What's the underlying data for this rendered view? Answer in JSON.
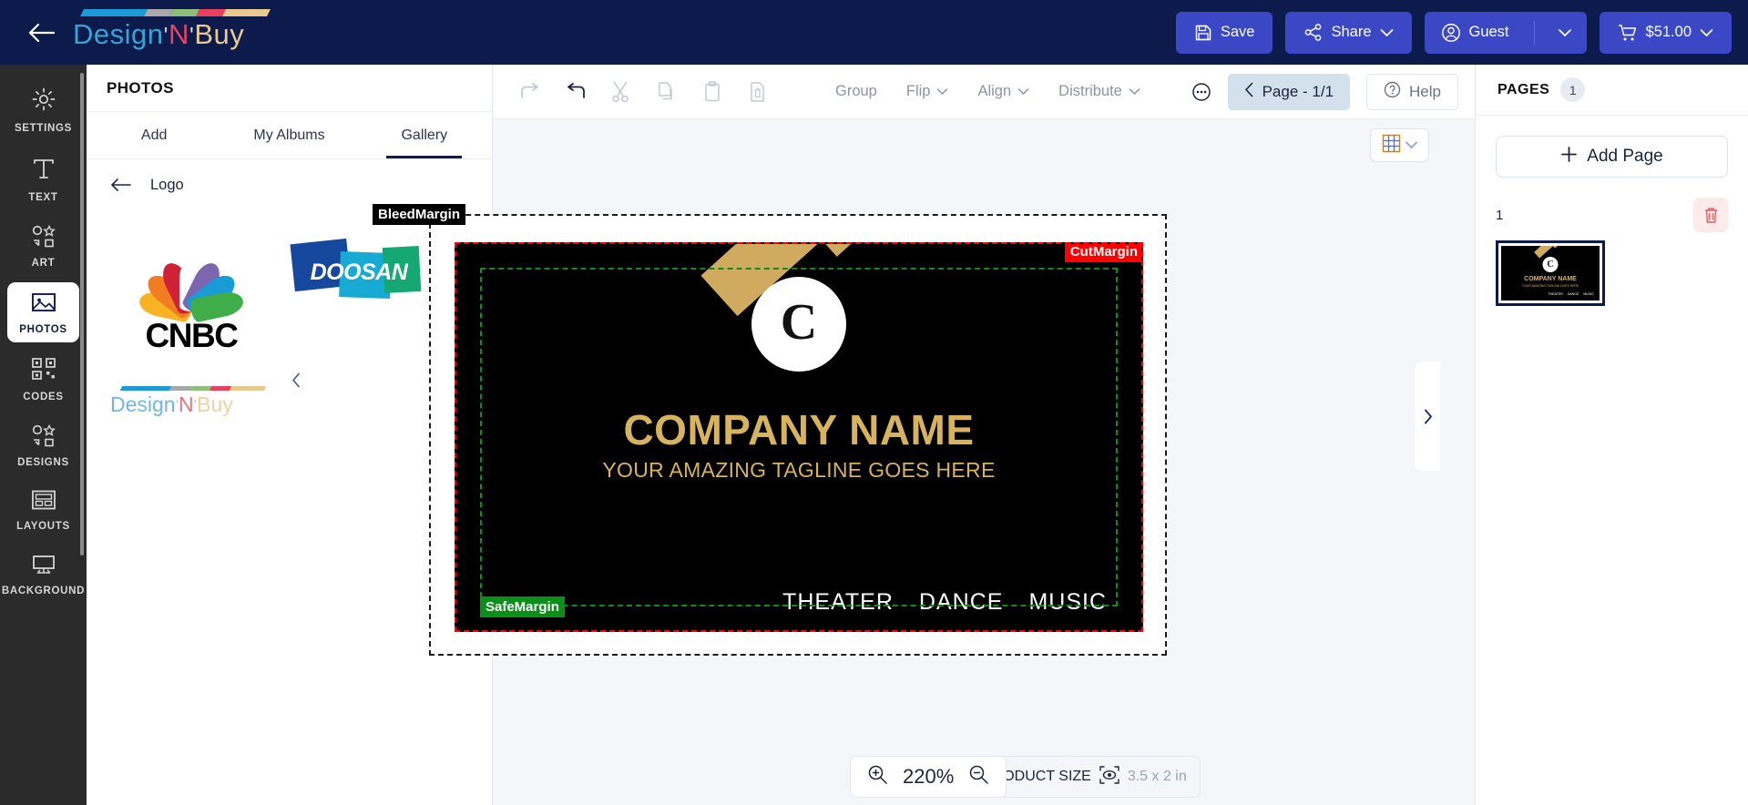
{
  "topbar": {
    "back_icon": "arrow-left-icon",
    "brand": {
      "part1": "Design",
      "quote1": "'",
      "part2": "N",
      "quote2": "'",
      "part3": "Buy"
    },
    "brand_bar_colors": [
      "#1c9ad6",
      "#a8a8a8",
      "#8cc07a",
      "#e8415e",
      "#e8c98e"
    ],
    "buttons": {
      "save": {
        "label": "Save",
        "icon": "save-floppy-icon"
      },
      "share": {
        "label": "Share",
        "icon": "share-nodes-icon",
        "caret": "chevron-down-icon"
      },
      "guest": {
        "label": "Guest",
        "icon": "user-circle-icon",
        "caret": "chevron-down-icon"
      },
      "cart": {
        "label": "$51.00",
        "icon": "shopping-cart-icon",
        "caret": "chevron-down-icon"
      }
    },
    "accent_color": "#3b48c6",
    "bar_color": "#0d1b4c"
  },
  "rail": {
    "items": [
      {
        "label": "SETTINGS",
        "icon": "gear-icon",
        "active": false
      },
      {
        "label": "TEXT",
        "icon": "text-t-icon",
        "active": false
      },
      {
        "label": "ART",
        "icon": "shapes-icon",
        "active": false
      },
      {
        "label": "PHOTOS",
        "icon": "image-icon",
        "active": true
      },
      {
        "label": "CODES",
        "icon": "qr-code-icon",
        "active": false
      },
      {
        "label": "DESIGNS",
        "icon": "shapes-icon",
        "active": false
      },
      {
        "label": "LAYOUTS",
        "icon": "layout-icon",
        "active": false
      },
      {
        "label": "BACKGROUND",
        "icon": "background-icon",
        "active": false
      }
    ]
  },
  "panel": {
    "title": "PHOTOS",
    "tabs": [
      {
        "label": "Add",
        "active": false
      },
      {
        "label": "My Albums",
        "active": false
      },
      {
        "label": "Gallery",
        "active": true
      }
    ],
    "breadcrumb": {
      "back_icon": "arrow-left-icon",
      "label": "Logo"
    },
    "gallery_items": [
      {
        "name": "CNBC",
        "type": "peacock-logo"
      },
      {
        "name": "DOOSAN",
        "type": "doosan-logo"
      },
      {
        "name": "Design 'N' Buy",
        "type": "dnb-logo"
      }
    ],
    "doosan_word": "DOOSAN",
    "cnbc_word": "CNBC"
  },
  "toolbar": {
    "icons": [
      {
        "name": "redo-icon",
        "disabled": true
      },
      {
        "name": "undo-icon",
        "disabled": false
      },
      {
        "name": "cut-scissors-icon",
        "disabled": true
      },
      {
        "name": "copy-icon",
        "disabled": true
      },
      {
        "name": "paste-icon",
        "disabled": true
      },
      {
        "name": "delete-file-icon",
        "disabled": true
      }
    ],
    "menus": [
      {
        "label": "Group",
        "caret": false
      },
      {
        "label": "Flip",
        "caret": true
      },
      {
        "label": "Align",
        "caret": true
      },
      {
        "label": "Distribute",
        "caret": true
      }
    ],
    "more_icon": "more-options-icon",
    "page_nav": {
      "prev_icon": "chevron-left-icon",
      "label": "Page - 1/1"
    },
    "help": {
      "label": "Help",
      "icon": "help-circle-icon"
    }
  },
  "canvas": {
    "grid_select": {
      "icon": "grid-icon",
      "caret": "chevron-down-icon"
    },
    "nav_left_icon": "chevron-left-icon",
    "nav_right_icon": "chevron-right-icon",
    "margins": {
      "bleed": {
        "label": "BleedMargin",
        "color": "#000000"
      },
      "cut": {
        "label": "CutMargin",
        "color": "#ff0000"
      },
      "safe": {
        "label": "SafeMargin",
        "color": "#0a8f18"
      }
    },
    "design": {
      "logo_letter": "C",
      "company_name": "COMPANY NAME",
      "tagline": "YOUR AMAZING TAGLINE GOES HERE",
      "footer_items": [
        "THEATER",
        "DANCE",
        "MUSIC"
      ],
      "background_color": "#000000",
      "gold_color": "#d0aa5f"
    },
    "zoom": {
      "in_icon": "zoom-in-icon",
      "level": "220%",
      "out_icon": "zoom-out-icon"
    },
    "product_size": {
      "label": "PRODUCT SIZE",
      "icon": "preview-eye-icon",
      "dimensions": "3.5 x 2 in"
    }
  },
  "pages": {
    "title": "PAGES",
    "count": "1",
    "add_button": {
      "label": "Add Page",
      "icon": "plus-icon"
    },
    "page_list": [
      {
        "number": "1",
        "delete_icon": "trash-icon",
        "selected": true
      }
    ]
  }
}
